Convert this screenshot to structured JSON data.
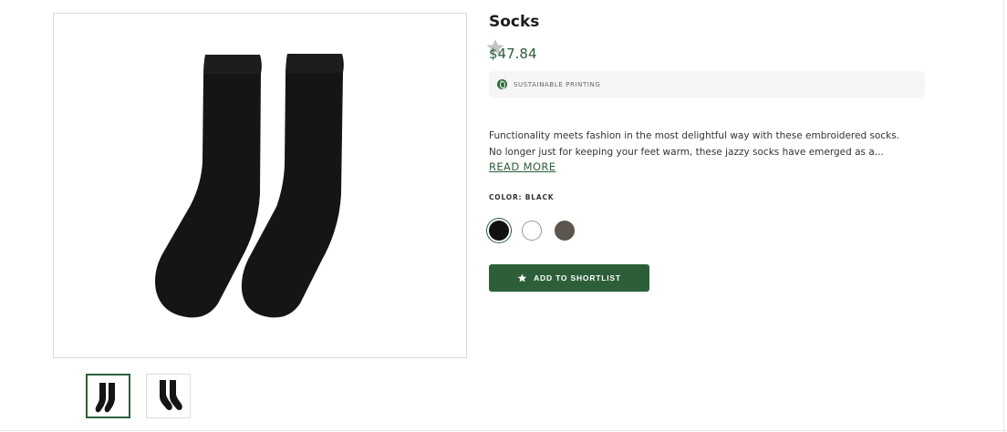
{
  "product": {
    "title": "Socks",
    "price": "$47.84",
    "badge": {
      "icon": "leaf-icon",
      "label": "SUSTAINABLE PRINTING"
    },
    "description_lines": [
      "Functionality meets fashion in the most delightful way with these embroidered socks.",
      "No longer just for keeping your feet warm, these jazzy socks have emerged as a..."
    ],
    "read_more_label": "READ MORE",
    "color_label": "COLOR: BLACK",
    "swatches": [
      {
        "name": "Black",
        "hex": "#111111",
        "selected": true
      },
      {
        "name": "White",
        "hex": "#ffffff",
        "selected": false
      },
      {
        "name": "Charcoal",
        "hex": "#5b544f",
        "selected": false
      }
    ],
    "shortlist_button": {
      "icon": "star-icon",
      "label": "ADD TO SHORTLIST"
    },
    "favorite_icon": "star-icon"
  },
  "gallery": {
    "images": [
      {
        "alt": "Black socks front",
        "active": true
      },
      {
        "alt": "Black socks side",
        "active": false
      }
    ]
  },
  "colors": {
    "accent": "#2d5e3a",
    "sock": "#151515"
  }
}
